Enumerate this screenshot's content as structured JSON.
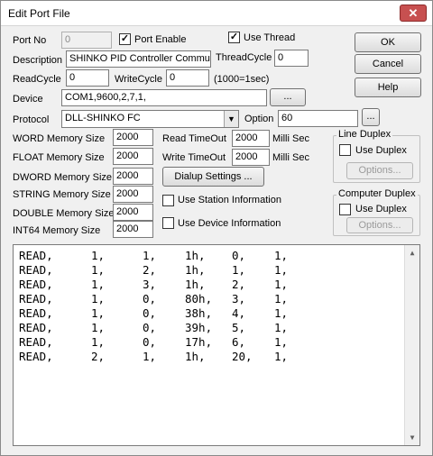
{
  "window": {
    "title": "Edit Port File",
    "close_glyph": "✕"
  },
  "fields": {
    "port_no_label": "Port No",
    "port_no_value": "0",
    "port_enable_label": "Port Enable",
    "port_enable_checked": "✓",
    "use_thread_label": "Use Thread",
    "use_thread_checked": "✓",
    "description_label": "Description",
    "description_value": "SHINKO PID Controller Communi",
    "thread_cycle_label": "ThreadCycle",
    "thread_cycle_value": "0",
    "read_cycle_label": "ReadCycle",
    "read_cycle_value": "0",
    "write_cycle_label": "WriteCycle",
    "write_cycle_value": "0",
    "cycle_hint": "(1000=1sec)",
    "device_label": "Device",
    "device_value": "COM1,9600,2,7,1,",
    "device_browse": "...",
    "protocol_label": "Protocol",
    "protocol_value": "DLL-SHINKO FC",
    "protocol_arrow": "▼",
    "option_label": "Option",
    "option_value": "60",
    "option_browse": "..."
  },
  "memory": {
    "word_label": "WORD Memory Size",
    "word_value": "2000",
    "float_label": "FLOAT Memory Size",
    "float_value": "2000",
    "dword_label": "DWORD Memory Size",
    "dword_value": "2000",
    "string_label": "STRING Memory Size",
    "string_value": "2000",
    "double_label": "DOUBLE Memory Size",
    "double_value": "2000",
    "int64_label": "INT64 Memory Size",
    "int64_value": "2000"
  },
  "timeouts": {
    "read_label": "Read TimeOut",
    "read_value": "2000",
    "read_unit": "Milli Sec",
    "write_label": "Write TimeOut",
    "write_value": "2000",
    "write_unit": "Milli Sec"
  },
  "dialup_button": "Dialup Settings ...",
  "use_station_label": "Use Station Information",
  "use_device_label": "Use Device Information",
  "buttons": {
    "ok": "OK",
    "cancel": "Cancel",
    "help": "Help"
  },
  "line_duplex": {
    "title": "Line Duplex",
    "use_label": "Use Duplex",
    "options": "Options..."
  },
  "computer_duplex": {
    "title": "Computer Duplex",
    "use_label": "Use Duplex",
    "options": "Options..."
  },
  "scroll": {
    "up": "▲",
    "down": "▼"
  },
  "lines": [
    [
      "READ,",
      "1,",
      "1,",
      "1h,",
      "0,",
      "1,"
    ],
    [
      "READ,",
      "1,",
      "2,",
      "1h,",
      "1,",
      "1,"
    ],
    [
      "READ,",
      "1,",
      "3,",
      "1h,",
      "2,",
      "1,"
    ],
    [
      "READ,",
      "1,",
      "0,",
      "80h,",
      "3,",
      "1,"
    ],
    [
      "READ,",
      "1,",
      "0,",
      "38h,",
      "4,",
      "1,"
    ],
    [
      "READ,",
      "1,",
      "0,",
      "39h,",
      "5,",
      "1,"
    ],
    [
      "READ,",
      "1,",
      "0,",
      "17h,",
      "6,",
      "1,"
    ],
    [
      "READ,",
      "2,",
      "1,",
      "1h,",
      "20,",
      "1,"
    ]
  ]
}
